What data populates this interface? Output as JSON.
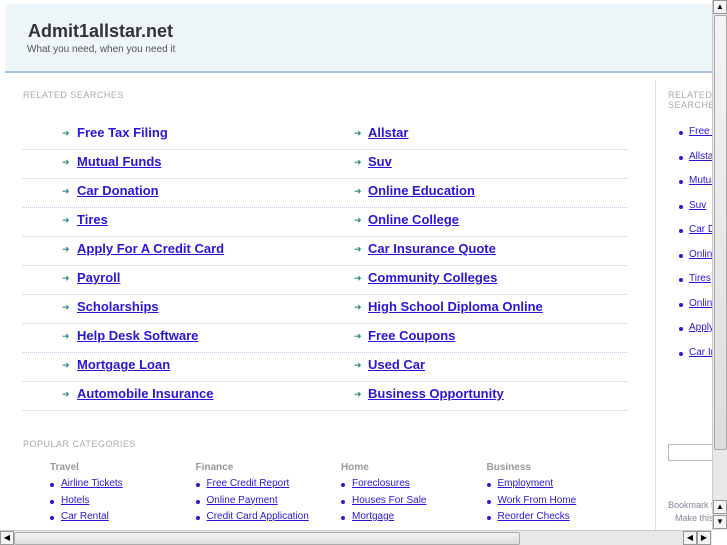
{
  "header": {
    "title": "Admit1allstar.net",
    "tagline": "What you need, when you need it"
  },
  "related": {
    "heading": "RELATED SEARCHES",
    "left": [
      "Free Tax Filing",
      "Mutual Funds",
      "Car Donation",
      "Tires",
      "Apply For A Credit Card",
      "Payroll",
      "Scholarships",
      "Help Desk Software",
      "Mortgage Loan",
      "Automobile Insurance"
    ],
    "right": [
      "Allstar",
      "Suv",
      "Online Education",
      "Online College",
      "Car Insurance Quote",
      "Community Colleges",
      "High School Diploma Online",
      "Free Coupons",
      "Used Car",
      "Business Opportunity"
    ]
  },
  "popular": {
    "heading": "POPULAR CATEGORIES",
    "categories": [
      {
        "title": "Travel",
        "items": [
          "Airline Tickets",
          "Hotels",
          "Car Rental"
        ]
      },
      {
        "title": "Finance",
        "items": [
          "Free Credit Report",
          "Online Payment",
          "Credit Card Application"
        ]
      },
      {
        "title": "Home",
        "items": [
          "Foreclosures",
          "Houses For Sale",
          "Mortgage"
        ]
      },
      {
        "title": "Business",
        "items": [
          "Employment",
          "Work From Home",
          "Reorder Checks"
        ]
      }
    ]
  },
  "sidebar": {
    "heading": "RELATED SEARCHES",
    "items": [
      "Free Tax Filing",
      "Allstar",
      "Mutual Funds",
      "Suv",
      "Car Donation",
      "Online Education",
      "Tires",
      "Online College",
      "Apply For A Credit Card",
      "Car Insurance Quote"
    ],
    "bookmark": "Bookmark this page",
    "make_home": "Make this your homepage"
  }
}
